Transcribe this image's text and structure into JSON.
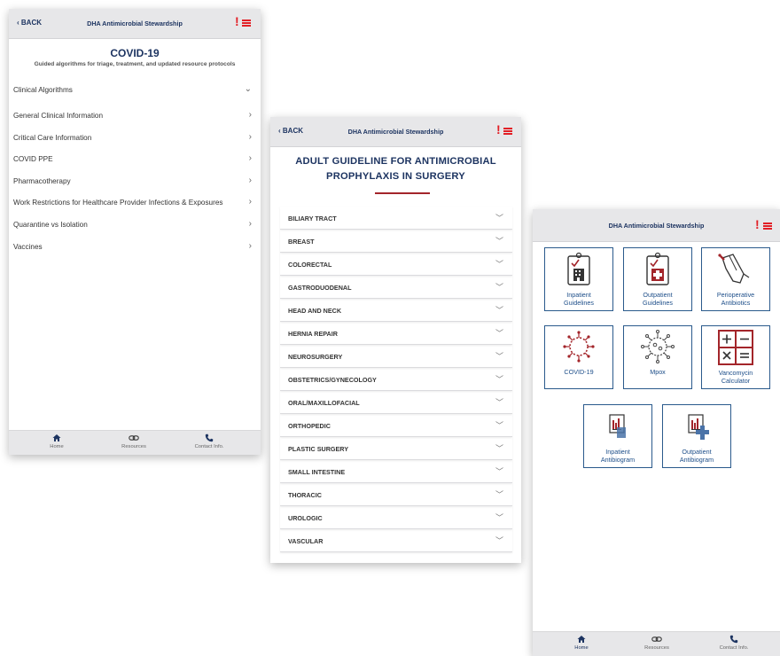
{
  "phone1": {
    "header": {
      "back": "‹ BACK",
      "title": "DHA Antimicrobial Stewardship",
      "alert": "!"
    },
    "title": "COVID-19",
    "subtitle": "Guided algorithms for triage, treatment, and updated resource protocols",
    "items": [
      {
        "label": "Clinical Algorithms",
        "arrow": "⌄"
      },
      {
        "label": "General Clinical Information",
        "arrow": "›"
      },
      {
        "label": "Critical Care Information",
        "arrow": "›"
      },
      {
        "label": "COVID PPE",
        "arrow": "›"
      },
      {
        "label": "Pharmacotherapy",
        "arrow": "›"
      },
      {
        "label": "Work Restrictions for Healthcare Provider Infections & Exposures",
        "arrow": "›"
      },
      {
        "label": "Quarantine vs Isolation",
        "arrow": "›"
      },
      {
        "label": "Vaccines",
        "arrow": "›"
      }
    ],
    "footer": {
      "home": "Home",
      "resources": "Resources",
      "contact": "Contact Info."
    }
  },
  "phone2": {
    "header": {
      "back": "‹ BACK",
      "title": "DHA Antimicrobial Stewardship",
      "alert": "!"
    },
    "title_line1": "ADULT GUIDELINE FOR ANTIMICROBIAL",
    "title_line2": "PROPHYLAXIS IN SURGERY",
    "sections": [
      "BILIARY TRACT",
      "BREAST",
      "COLORECTAL",
      "GASTRODUODENAL",
      "HEAD AND NECK",
      "HERNIA REPAIR",
      "NEUROSURGERY",
      "OBSTETRICS/GYNECOLOGY",
      "ORAL/MAXILLOFACIAL",
      "ORTHOPEDIC",
      "PLASTIC SURGERY",
      "SMALL INTESTINE",
      "THORACIC",
      "UROLOGIC",
      "VASCULAR"
    ]
  },
  "phone3": {
    "header": {
      "title": "DHA Antimicrobial Stewardship",
      "alert": "!"
    },
    "tiles": [
      {
        "line1": "Inpatient",
        "line2": "Guidelines",
        "icon": "inpatient-clipboard-icon"
      },
      {
        "line1": "Outpatient",
        "line2": "Guidelines",
        "icon": "outpatient-clipboard-icon"
      },
      {
        "line1": "Perioperative",
        "line2": "Antibiotics",
        "icon": "surgical-glove-icon"
      },
      {
        "line1": "COVID-19",
        "line2": "",
        "icon": "coronavirus-icon"
      },
      {
        "line1": "Mpox",
        "line2": "",
        "icon": "virus-icon"
      },
      {
        "line1": "Vancomycin",
        "line2": "Calculator",
        "icon": "calculator-icon"
      },
      {
        "line1": "Inpatient",
        "line2": "Antibiogram",
        "icon": "inpatient-antibiogram-icon"
      },
      {
        "line1": "Outpatient",
        "line2": "Antibiogram",
        "icon": "outpatient-antibiogram-icon"
      }
    ],
    "footer": {
      "home": "Home",
      "resources": "Resources",
      "contact": "Contact Info."
    }
  },
  "colors": {
    "navy": "#1d3461",
    "alert_red": "#e21f26",
    "tile_border": "#2a5a8c",
    "accent_maroon": "#a3252a"
  }
}
